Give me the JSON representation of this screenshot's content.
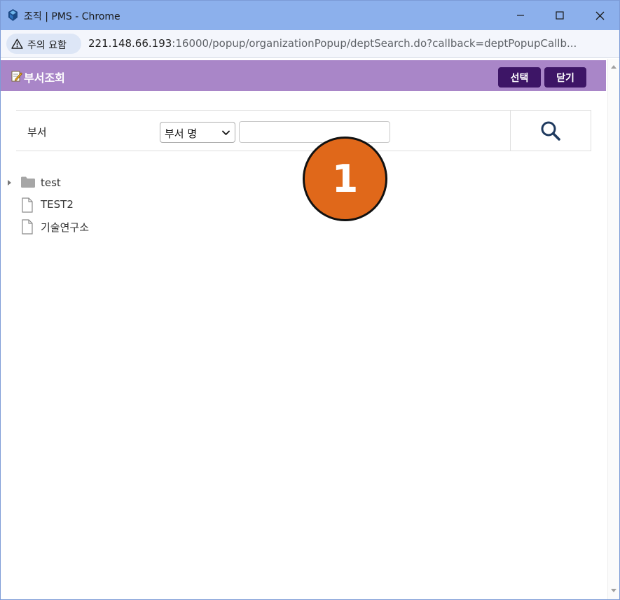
{
  "window": {
    "title": "조직 | PMS - Chrome",
    "controls": {
      "minimize": "minimize",
      "maximize": "maximize",
      "close": "close"
    }
  },
  "addressbar": {
    "security_label": "주의 요함",
    "url_host": "221.148.66.193",
    "url_path": ":16000/popup/organizationPopup/deptSearch.do?callback=deptPopupCallb..."
  },
  "popup": {
    "title": "부서조회",
    "select_button": "선택",
    "close_button": "닫기"
  },
  "search": {
    "label": "부서",
    "field_selected": "부서 명",
    "input_value": "",
    "input_placeholder": ""
  },
  "tree": {
    "items": [
      {
        "label": "test",
        "type": "folder",
        "expandable": true
      },
      {
        "label": "TEST2",
        "type": "file",
        "expandable": false
      },
      {
        "label": "기술연구소",
        "type": "file",
        "expandable": false
      }
    ]
  },
  "annotation": {
    "step_number": "1",
    "color": "#e0681a"
  },
  "colors": {
    "titlebar": "#8cb0ec",
    "popup_header": "#a986c8",
    "button_bg": "#3d1566",
    "search_icon": "#1f3a5f"
  },
  "icons": {
    "app": "pms-app-icon",
    "security": "warning-triangle-icon",
    "popup": "edit-note-icon",
    "search": "search-icon",
    "folder": "folder-icon",
    "file": "file-icon"
  }
}
